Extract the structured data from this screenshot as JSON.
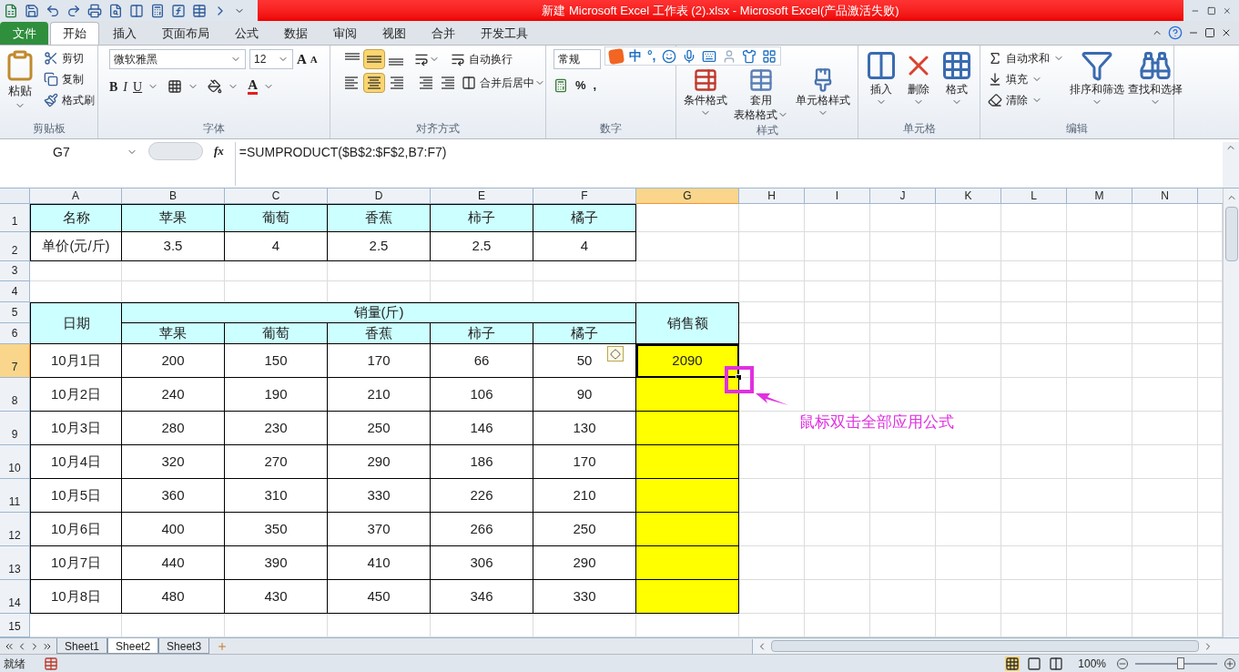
{
  "title": "新建 Microsoft Excel 工作表 (2).xlsx - Microsoft Excel(产品激活失败)",
  "tabs": [
    {
      "label": "文件",
      "kind": "file",
      "selected": false
    },
    {
      "label": "开始",
      "kind": "tab",
      "selected": true
    },
    {
      "label": "插入",
      "kind": "tab",
      "selected": false
    },
    {
      "label": "页面布局",
      "kind": "tab",
      "selected": false
    },
    {
      "label": "公式",
      "kind": "tab",
      "selected": false
    },
    {
      "label": "数据",
      "kind": "tab",
      "selected": false
    },
    {
      "label": "审阅",
      "kind": "tab",
      "selected": false
    },
    {
      "label": "视图",
      "kind": "tab",
      "selected": false
    },
    {
      "label": "合并",
      "kind": "tab",
      "selected": false
    },
    {
      "label": "开发工具",
      "kind": "tab",
      "selected": false
    }
  ],
  "ribbon": [
    {
      "kind": "clipboard",
      "label": "剪贴板",
      "paste": "粘贴",
      "items": [
        "剪切",
        "复制",
        "格式刷"
      ]
    },
    {
      "kind": "font",
      "label": "字体",
      "font": "微软雅黑",
      "size": "12",
      "grow": "A",
      "shrink": "A",
      "styles": [
        "B",
        "I",
        "U"
      ],
      "font_color": "A"
    },
    {
      "kind": "align",
      "label": "对齐方式",
      "vertical": [
        {
          "selected": false
        },
        {
          "selected": true
        },
        {
          "selected": false
        }
      ],
      "horizontal": [
        {
          "selected": false
        },
        {
          "selected": true
        },
        {
          "selected": false
        }
      ],
      "wrap": "自动换行",
      "merge": "合并后居中"
    },
    {
      "kind": "number",
      "label": "数字",
      "format": "常规",
      "symbols": [
        "%",
        ","
      ]
    },
    {
      "kind": "big",
      "label": "样式",
      "buttons": [
        {
          "lines": [
            "条件格式"
          ]
        },
        {
          "lines": [
            "套用",
            "表格格式"
          ]
        },
        {
          "lines": [
            "单元格样式"
          ]
        }
      ]
    },
    {
      "kind": "big",
      "label": "单元格",
      "buttons": [
        {
          "lines": [
            "插入"
          ]
        },
        {
          "lines": [
            "删除"
          ]
        },
        {
          "lines": [
            "格式"
          ]
        }
      ]
    },
    {
      "kind": "edit",
      "label": "编辑",
      "items": [
        "自动求和",
        "填充",
        "清除"
      ],
      "buttons": [
        {
          "lines": [
            "排序和筛选"
          ]
        },
        {
          "lines": [
            "查找和选择"
          ]
        }
      ]
    }
  ],
  "ime_bar": {
    "items": [
      "中",
      "°,"
    ]
  },
  "name_box": "G7",
  "fx": "fx",
  "formula": "=SUMPRODUCT($B$2:$F$2,B7:F7)",
  "columns": [
    {
      "label": "A",
      "selected": false
    },
    {
      "label": "B",
      "selected": false
    },
    {
      "label": "C",
      "selected": false
    },
    {
      "label": "D",
      "selected": false
    },
    {
      "label": "E",
      "selected": false
    },
    {
      "label": "F",
      "selected": false
    },
    {
      "label": "G",
      "selected": true
    },
    {
      "label": "H",
      "selected": false
    },
    {
      "label": "I",
      "selected": false
    },
    {
      "label": "J",
      "selected": false
    },
    {
      "label": "K",
      "selected": false
    },
    {
      "label": "L",
      "selected": false
    },
    {
      "label": "M",
      "selected": false
    },
    {
      "label": "N",
      "selected": false
    }
  ],
  "rows": [
    {
      "label": "1",
      "selected": false,
      "cells": [
        {
          "kind": "cell",
          "text": "名称",
          "color": "#ccffff"
        },
        {
          "kind": "cell",
          "text": "苹果",
          "color": "#ccffff"
        },
        {
          "kind": "cell",
          "text": "葡萄",
          "color": "#ccffff"
        },
        {
          "kind": "cell",
          "text": "香蕉",
          "color": "#ccffff"
        },
        {
          "kind": "cell",
          "text": "柿子",
          "color": "#ccffff"
        },
        {
          "kind": "cell",
          "text": "橘子",
          "color": "#ccffff"
        }
      ]
    },
    {
      "label": "2",
      "selected": false,
      "cells": [
        {
          "kind": "cell",
          "text": "单价(元/斤)",
          "color": "#ffffff"
        },
        {
          "kind": "cell",
          "text": "3.5",
          "color": "#ffffff"
        },
        {
          "kind": "cell",
          "text": "4",
          "color": "#ffffff"
        },
        {
          "kind": "cell",
          "text": "2.5",
          "color": "#ffffff"
        },
        {
          "kind": "cell",
          "text": "2.5",
          "color": "#ffffff"
        },
        {
          "kind": "cell",
          "text": "4",
          "color": "#ffffff"
        }
      ]
    },
    {
      "label": "3",
      "selected": false
    },
    {
      "label": "4",
      "selected": false
    },
    {
      "label": "5",
      "selected": false,
      "cells": [
        {
          "kind": "tall",
          "text": "日期",
          "color": "#ccffff"
        },
        {
          "kind": "wide",
          "text": "销量(斤)",
          "color": "#ccffff"
        },
        {
          "kind": "tall",
          "text": "销售额",
          "color": "#ccffff"
        }
      ]
    },
    {
      "label": "6",
      "selected": false,
      "cells": [
        {
          "kind": "cell",
          "text": "苹果",
          "color": "#ccffff"
        },
        {
          "kind": "cell",
          "text": "葡萄",
          "color": "#ccffff"
        },
        {
          "kind": "cell",
          "text": "香蕉",
          "color": "#ccffff"
        },
        {
          "kind": "cell",
          "text": "柿子",
          "color": "#ccffff"
        },
        {
          "kind": "cell",
          "text": "橘子",
          "color": "#ccffff"
        }
      ]
    },
    {
      "label": "7",
      "selected": true,
      "cells": [
        {
          "kind": "cell",
          "text": "10月1日",
          "color": "#ffffff"
        },
        {
          "kind": "cell",
          "text": "200",
          "color": "#ffffff"
        },
        {
          "kind": "cell",
          "text": "150",
          "color": "#ffffff"
        },
        {
          "kind": "cell",
          "text": "170",
          "color": "#ffffff"
        },
        {
          "kind": "cell",
          "text": "66",
          "color": "#ffffff"
        },
        {
          "kind": "cell",
          "text": "50",
          "color": "#ffffff"
        },
        {
          "kind": "cell",
          "text": "2090",
          "color": "#ffff00"
        }
      ]
    },
    {
      "label": "8",
      "selected": false,
      "cells": [
        {
          "kind": "cell",
          "text": "10月2日",
          "color": "#ffffff"
        },
        {
          "kind": "cell",
          "text": "240",
          "color": "#ffffff"
        },
        {
          "kind": "cell",
          "text": "190",
          "color": "#ffffff"
        },
        {
          "kind": "cell",
          "text": "210",
          "color": "#ffffff"
        },
        {
          "kind": "cell",
          "text": "106",
          "color": "#ffffff"
        },
        {
          "kind": "cell",
          "text": "90",
          "color": "#ffffff"
        },
        {
          "kind": "cell",
          "color": "#ffff00"
        }
      ]
    },
    {
      "label": "9",
      "selected": false,
      "cells": [
        {
          "kind": "cell",
          "text": "10月3日",
          "color": "#ffffff"
        },
        {
          "kind": "cell",
          "text": "280",
          "color": "#ffffff"
        },
        {
          "kind": "cell",
          "text": "230",
          "color": "#ffffff"
        },
        {
          "kind": "cell",
          "text": "250",
          "color": "#ffffff"
        },
        {
          "kind": "cell",
          "text": "146",
          "color": "#ffffff"
        },
        {
          "kind": "cell",
          "text": "130",
          "color": "#ffffff"
        },
        {
          "kind": "cell",
          "color": "#ffff00"
        }
      ]
    },
    {
      "label": "10",
      "selected": false,
      "cells": [
        {
          "kind": "cell",
          "text": "10月4日",
          "color": "#ffffff"
        },
        {
          "kind": "cell",
          "text": "320",
          "color": "#ffffff"
        },
        {
          "kind": "cell",
          "text": "270",
          "color": "#ffffff"
        },
        {
          "kind": "cell",
          "text": "290",
          "color": "#ffffff"
        },
        {
          "kind": "cell",
          "text": "186",
          "color": "#ffffff"
        },
        {
          "kind": "cell",
          "text": "170",
          "color": "#ffffff"
        },
        {
          "kind": "cell",
          "color": "#ffff00"
        }
      ]
    },
    {
      "label": "11",
      "selected": false,
      "cells": [
        {
          "kind": "cell",
          "text": "10月5日",
          "color": "#ffffff"
        },
        {
          "kind": "cell",
          "text": "360",
          "color": "#ffffff"
        },
        {
          "kind": "cell",
          "text": "310",
          "color": "#ffffff"
        },
        {
          "kind": "cell",
          "text": "330",
          "color": "#ffffff"
        },
        {
          "kind": "cell",
          "text": "226",
          "color": "#ffffff"
        },
        {
          "kind": "cell",
          "text": "210",
          "color": "#ffffff"
        },
        {
          "kind": "cell",
          "color": "#ffff00"
        }
      ]
    },
    {
      "label": "12",
      "selected": false,
      "cells": [
        {
          "kind": "cell",
          "text": "10月6日",
          "color": "#ffffff"
        },
        {
          "kind": "cell",
          "text": "400",
          "color": "#ffffff"
        },
        {
          "kind": "cell",
          "text": "350",
          "color": "#ffffff"
        },
        {
          "kind": "cell",
          "text": "370",
          "color": "#ffffff"
        },
        {
          "kind": "cell",
          "text": "266",
          "color": "#ffffff"
        },
        {
          "kind": "cell",
          "text": "250",
          "color": "#ffffff"
        },
        {
          "kind": "cell",
          "color": "#ffff00"
        }
      ]
    },
    {
      "label": "13",
      "selected": false,
      "cells": [
        {
          "kind": "cell",
          "text": "10月7日",
          "color": "#ffffff"
        },
        {
          "kind": "cell",
          "text": "440",
          "color": "#ffffff"
        },
        {
          "kind": "cell",
          "text": "390",
          "color": "#ffffff"
        },
        {
          "kind": "cell",
          "text": "410",
          "color": "#ffffff"
        },
        {
          "kind": "cell",
          "text": "306",
          "color": "#ffffff"
        },
        {
          "kind": "cell",
          "text": "290",
          "color": "#ffffff"
        },
        {
          "kind": "cell",
          "color": "#ffff00"
        }
      ]
    },
    {
      "label": "14",
      "selected": false,
      "cells": [
        {
          "kind": "cell",
          "text": "10月8日",
          "color": "#ffffff"
        },
        {
          "kind": "cell",
          "text": "480",
          "color": "#ffffff"
        },
        {
          "kind": "cell",
          "text": "430",
          "color": "#ffffff"
        },
        {
          "kind": "cell",
          "text": "450",
          "color": "#ffffff"
        },
        {
          "kind": "cell",
          "text": "346",
          "color": "#ffffff"
        },
        {
          "kind": "cell",
          "text": "330",
          "color": "#ffffff"
        },
        {
          "kind": "cell",
          "color": "#ffff00"
        }
      ]
    },
    {
      "label": "15",
      "selected": false
    }
  ],
  "annotation": "鼠标双击全部应用公式",
  "sheet_tabs": [
    {
      "label": "Sheet1",
      "selected": false
    },
    {
      "label": "Sheet2",
      "selected": true
    },
    {
      "label": "Sheet3",
      "selected": false
    }
  ],
  "status": "就绪",
  "zoom": {
    "reading": "100%",
    "level": 0.55
  }
}
